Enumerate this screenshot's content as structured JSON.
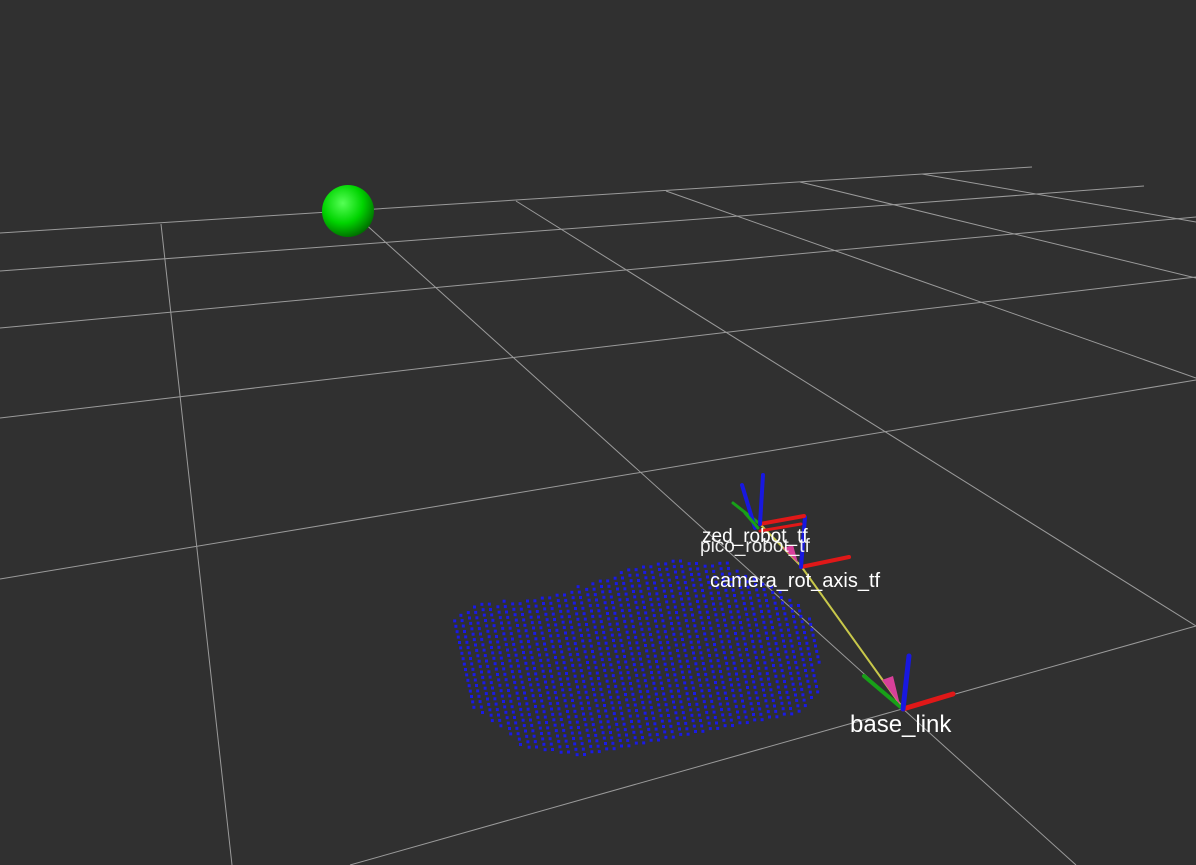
{
  "scene": {
    "background": "#303030",
    "grid_color": "#a0a0a0",
    "marker": {
      "shape": "sphere",
      "color": "#00e000"
    },
    "pointcloud": {
      "color": "#1a1ae6"
    },
    "tf_link_color": "#c8c84a",
    "axis_colors": {
      "x": "#e01818",
      "y": "#18a018",
      "z": "#1818e0"
    },
    "arrow_color": "#d8409a"
  },
  "frames": {
    "zed": {
      "label": "zed_robot_tf"
    },
    "pico": {
      "label": "pico_robot_tf"
    },
    "camera": {
      "label": "camera_rot_axis_tf"
    },
    "base": {
      "label": "base_link"
    }
  }
}
